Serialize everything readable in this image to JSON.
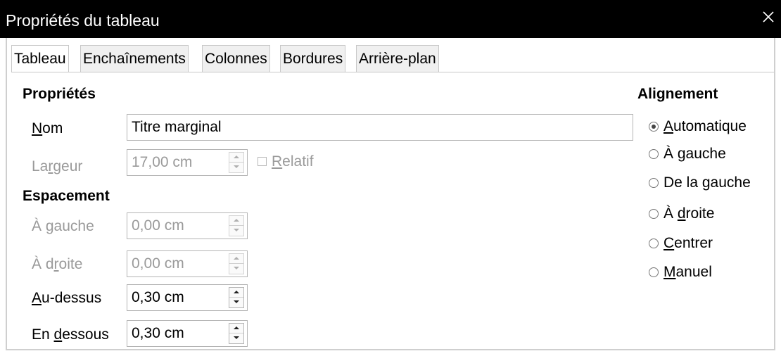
{
  "window": {
    "title": "Propriétés du tableau"
  },
  "tabs": [
    {
      "label": "Tableau",
      "active": true
    },
    {
      "label": "Enchaînements",
      "active": false
    },
    {
      "label": "Colonnes",
      "active": false
    },
    {
      "label": "Bordures",
      "active": false
    },
    {
      "label": "Arrière-plan",
      "active": false
    }
  ],
  "properties": {
    "heading": "Propriétés",
    "name": {
      "label": {
        "mn": "N",
        "rest": "om"
      },
      "value": "Titre marginal"
    },
    "width": {
      "label": {
        "pre": "La",
        "mn": "r",
        "post": "geur"
      },
      "value": "17,00 cm",
      "enabled": false
    },
    "relative": {
      "label": {
        "mn": "R",
        "rest": "elatif"
      },
      "checked": false,
      "enabled": false
    }
  },
  "spacing": {
    "heading": "Espacement",
    "left": {
      "label": {
        "pre": "À ",
        "mn": "g",
        "post": "auche"
      },
      "value": "0,00 cm",
      "enabled": false
    },
    "right": {
      "label": {
        "pre": "À d",
        "mn": "r",
        "post": "oite"
      },
      "value": "0,00 cm",
      "enabled": false
    },
    "above": {
      "label": {
        "pre": "",
        "mn": "A",
        "post": "u-dessus"
      },
      "value": "0,30 cm",
      "enabled": true
    },
    "below": {
      "label": {
        "pre": "En ",
        "mn": "d",
        "post": "essous"
      },
      "value": "0,30 cm",
      "enabled": true
    }
  },
  "alignment": {
    "heading": "Alignement",
    "options": [
      {
        "pre": "",
        "mn": "A",
        "post": "utomatique",
        "selected": true
      },
      {
        "pre": "À ",
        "mn": "g",
        "post": "auche",
        "selected": false
      },
      {
        "pre": "De la ",
        "mn": "g",
        "post": "auche",
        "selected": false
      },
      {
        "pre": "À ",
        "mn": "d",
        "post": "roite",
        "selected": false
      },
      {
        "pre": "",
        "mn": "C",
        "post": "entrer",
        "selected": false
      },
      {
        "pre": "",
        "mn": "M",
        "post": "anuel",
        "selected": false
      }
    ]
  }
}
